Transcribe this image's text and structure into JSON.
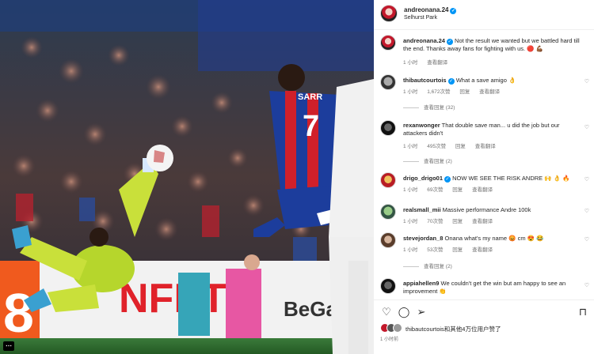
{
  "post": {
    "username": "andreonana.24",
    "location": "Selhurst Park",
    "time": "1 小时"
  },
  "photo": {
    "player_name": "SARR",
    "player_number": "7",
    "ad_text_left": "8",
    "ad_text_mid": "NFET",
    "ad_text_right": "BeGam",
    "menu_glyph": "⋯"
  },
  "caption": {
    "username": "andreonana.24",
    "text": "Not the result we wanted but we battled hard till the end. Thanks away fans for fighting with us. 🔴 💪🏾",
    "time": "1 小时",
    "translate": "查看翻译"
  },
  "comments": [
    {
      "username": "thibautcourtois",
      "verified": true,
      "text": "What a save amigo 👌",
      "time": "1 小时",
      "likes": "1,672次赞",
      "reply": "回复",
      "translate": "查看翻译",
      "replies": "查看回复 (32)"
    },
    {
      "username": "rexanwonger",
      "verified": false,
      "text": "That double save man... u did the job but our attackers didn't",
      "time": "1 小时",
      "likes": "495次赞",
      "reply": "回复",
      "translate": "查看翻译",
      "replies": "查看回复 (2)"
    },
    {
      "username": "drigo_drigo01",
      "verified": true,
      "text": "NOW WE SEE THE RISK ANDRE 🙌 👌 🔥",
      "time": "1 小时",
      "likes": "69次赞",
      "reply": "回复",
      "translate": "查看翻译",
      "replies": ""
    },
    {
      "username": "realsmall_mii",
      "verified": false,
      "text": "Massive performance Andre 100k",
      "time": "1 小时",
      "likes": "70次赞",
      "reply": "回复",
      "translate": "查看翻译",
      "replies": ""
    },
    {
      "username": "stevejordan_8",
      "verified": false,
      "text": "Onana what's my name 😡 cm 😍 😂",
      "time": "1 小时",
      "likes": "53次赞",
      "reply": "回复",
      "translate": "查看翻译",
      "replies": "查看回复 (2)"
    },
    {
      "username": "appiahellen9",
      "verified": false,
      "text": "We couldn't get the win but am happy to see an improvement 👏",
      "time": "",
      "likes": "",
      "reply": "",
      "translate": "",
      "replies": ""
    }
  ],
  "likes_text": "thibautcourtois和其他4万位用户赞了",
  "likes_user": "thibautcourtois",
  "post_time": "1 小时前"
}
